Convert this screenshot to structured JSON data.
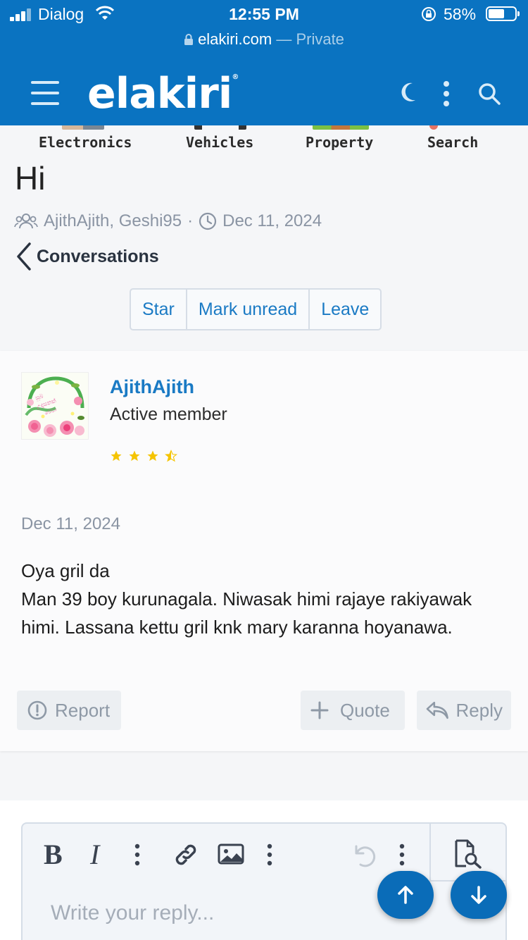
{
  "status_bar": {
    "carrier": "Dialog",
    "time": "12:55 PM",
    "battery": "58%",
    "battery_level": 0.58
  },
  "browser": {
    "domain": "elakiri.com",
    "mode": "— Private"
  },
  "header": {
    "logo": "elakiri",
    "logo_mark": "®",
    "icons": [
      "menu-icon",
      "moon-icon",
      "more-vertical-icon",
      "search-icon"
    ]
  },
  "categories": [
    "Electronics",
    "Vehicles",
    "Property",
    "Search"
  ],
  "conversation": {
    "title": "Hi",
    "participants": "AjithAjith, Geshi95",
    "separator": "·",
    "date": "Dec 11, 2024",
    "back_label": "Conversations",
    "actions": [
      "Star",
      "Mark unread",
      "Leave"
    ]
  },
  "message": {
    "username": "AjithAjith",
    "role": "Active member",
    "rating": 3.5,
    "date": "Dec 11, 2024",
    "lines": [
      "Oya gril da",
      "Man 39 boy kurunagala. Niwasak himi rajaye rakiyawak himi. Lassana kettu gril knk mary karanna hoyanawa."
    ],
    "report_label": "Report",
    "quote_label": "Quote",
    "reply_label": "Reply"
  },
  "editor": {
    "placeholder": "Write your reply...",
    "bold_label": "B",
    "italic_label": "I"
  },
  "colors": {
    "brand": "#0a73c1",
    "link": "#1a7ac4",
    "muted": "#8a94a3",
    "star": "#f5c400"
  }
}
